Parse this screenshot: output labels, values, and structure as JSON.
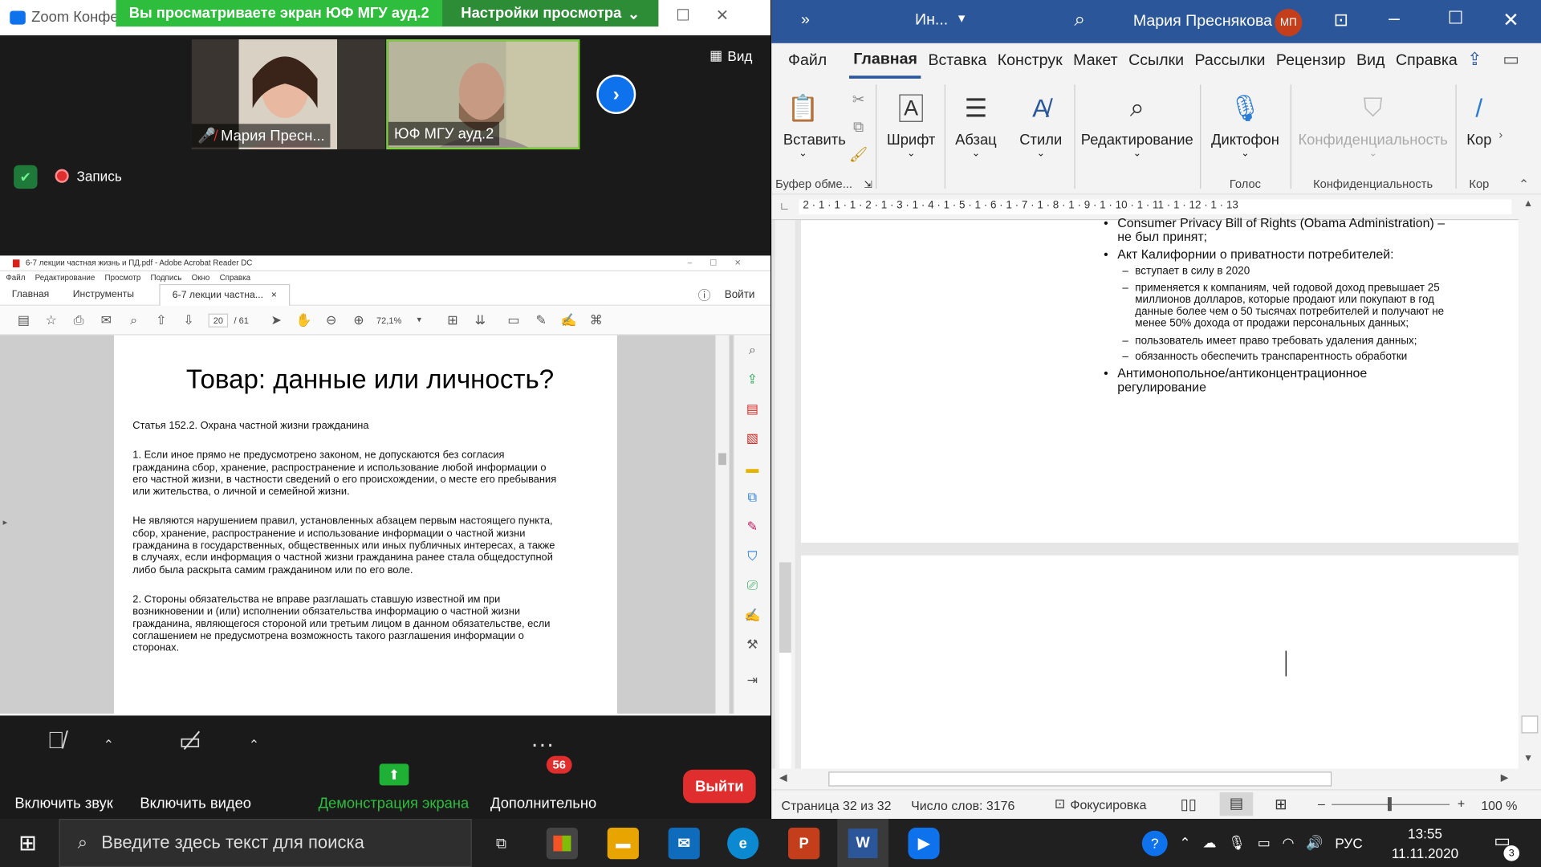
{
  "zoom": {
    "title": "Zoom Конфе",
    "share_banner": "Вы просматриваете экран ЮФ МГУ ауд.2",
    "view_settings": "Настройки просмотра",
    "view_btn": "Вид",
    "participant1": "Мария Пресн...",
    "participant2": "ЮФ МГУ ауд.2",
    "recording": "Запись",
    "mute_label": "Включить звук",
    "video_label": "Включить видео",
    "share_label": "Демонстрация экрана",
    "more_label": "Дополнительно",
    "more_badge": "56",
    "exit_label": "Выйти"
  },
  "acrobat": {
    "title": "6-7 лекции частная жизнь и ПД.pdf - Adobe Acrobat Reader DC",
    "menu": [
      "Файл",
      "Редактирование",
      "Просмотр",
      "Подпись",
      "Окно",
      "Справка"
    ],
    "tabs": {
      "home": "Главная",
      "tools": "Инструменты",
      "doc": "6-7 лекции частна..."
    },
    "signin": "Войти",
    "page_current": "20",
    "page_total": "/ 61",
    "zoom": "72,1%",
    "page": {
      "title": "Товар: данные или личность?",
      "p1": "Статья 152.2. Охрана частной жизни гражданина",
      "p2": "1. Если иное прямо не предусмотрено законом, не допускаются без согласия\nгражданина сбор, хранение, распространение и использование любой информации о\nего частной жизни, в частности сведений о его происхождении, о месте его пребывания\nили жительства, о личной и семейной жизни.",
      "p3": "Не являются нарушением правил, установленных абзацем первым настоящего пункта,\nсбор, хранение, распространение и использование информации о частной жизни\nгражданина в государственных, общественных или иных публичных интересах, а также\nв случаях, если информация о частной жизни гражданина ранее стала общедоступной\nлибо была раскрыта самим гражданином или по его воле.",
      "p4": "2. Стороны обязательства не вправе разглашать ставшую известной им при\nвозникновении и (или) исполнении обязательства информацию о частной жизни\nгражданина, являющегося стороной или третьим лицом в данном обязательстве, если\nсоглашением не предусмотрена возможность такого разглашения информации о\nсторонах."
    }
  },
  "word": {
    "title": "Ин...",
    "user": "Мария Преснякова",
    "initials": "МП",
    "tabs": [
      "Файл",
      "Главная",
      "Вставка",
      "Конструк",
      "Макет",
      "Ссылки",
      "Рассылки",
      "Рецензир",
      "Вид",
      "Справка"
    ],
    "ribbon": {
      "paste": "Вставить",
      "clipboard": "Буфер обме...",
      "font": "Шрифт",
      "paragraph": "Абзац",
      "styles": "Стили",
      "editing": "Редактирование",
      "dictate": "Диктофон",
      "voice": "Голос",
      "sensitivity": "Конфиденциальность",
      "sensitivity_group": "Конфиденциальность",
      "more": "Кор",
      "more_group": "Кор"
    },
    "ruler": "2 · 1 · 1 · 1 · 2 · 1 · 3 · 1 · 4 · 1 · 5 · 1 · 6 · 1 · 7 · 1 · 8 · 1 · 9 · 1 · 10 · 1 · 11 · 1 · 12 · 1 · 13",
    "doc": {
      "l1": "Consumer Privacy Bill of Rights (Obama Administration) –",
      "l2": "не был принят;",
      "l3": "Акт Калифорнии о приватности потребителей:",
      "l4": "вступает в силу в 2020",
      "l5": "применяется к компаниям, чей годовой доход превышает 25",
      "l6": "миллионов долларов, которые продают или покупают в год",
      "l7": "данные более чем о 50 тысячах потребителей и получают не",
      "l8": "менее 50% дохода от продажи персональных данных;",
      "l9": "пользователь имеет право требовать удаления данных;",
      "l10": "обязанность обеспечить транспарентность обработки",
      "l11": "Антимонопольное/антиконцентрационное",
      "l12": "регулирование"
    },
    "status": {
      "page": "Страница 32 из 32",
      "words": "Число слов: 3176",
      "focus": "Фокусировка",
      "zoom": "100 %"
    }
  },
  "taskbar": {
    "search_placeholder": "Введите здесь текст для поиска",
    "lang": "РУС",
    "time": "13:55",
    "date": "11.11.2020",
    "notif": "3"
  }
}
